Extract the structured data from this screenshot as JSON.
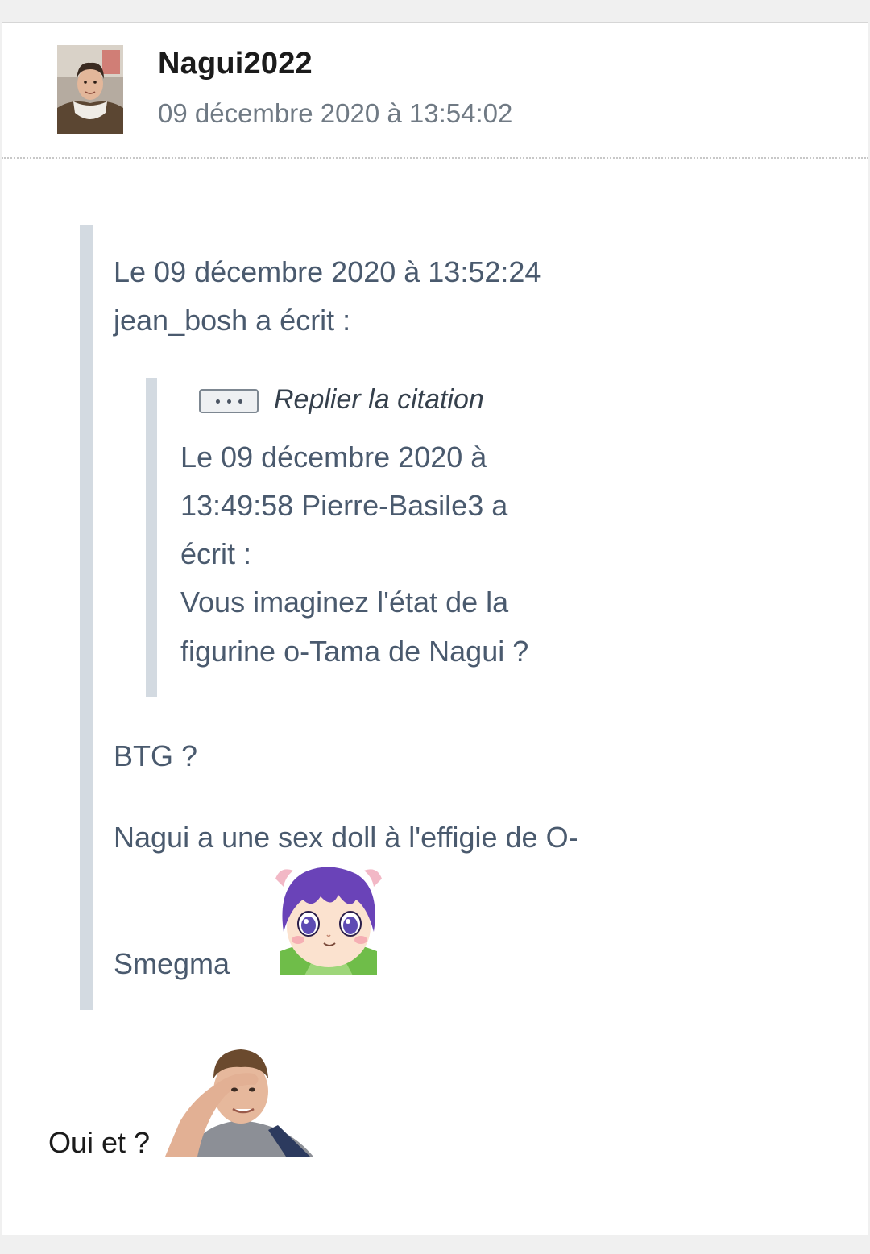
{
  "post": {
    "author": "Nagui2022",
    "date": "09 décembre 2020 à 13:54:02"
  },
  "quote_outer": {
    "header_line1": "Le 09 décembre 2020 à 13:52:24",
    "header_line2": "jean_bosh a écrit :",
    "lines": [
      "BTG ?",
      "Nagui a une sex doll à l'effigie de O-",
      "Smegma"
    ]
  },
  "quote_inner": {
    "collapse_label": "Replier la citation",
    "lines": [
      "Le 09 décembre 2020 à",
      "13:49:58 Pierre-Basile3 a",
      "écrit :",
      "Vous imaginez l'état de la",
      "figurine o-Tama de Nagui ?"
    ]
  },
  "reply": {
    "text": "Oui et ?"
  },
  "colors": {
    "quote_bar": "#d3dae1",
    "quote_text": "#4a5a6e",
    "meta_text": "#707a84"
  },
  "icons": {
    "collapse": "ellipsis-icon",
    "avatar": "user-avatar",
    "sticker1": "anime-girl-sticker",
    "sticker2": "facepalm-sticker"
  }
}
